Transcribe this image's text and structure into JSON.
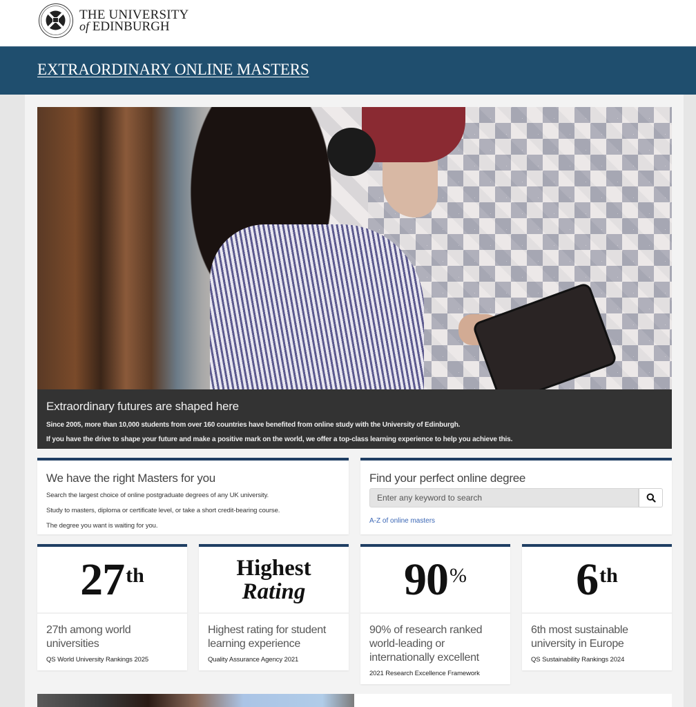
{
  "header": {
    "logo_line1": "THE UNIVERSITY",
    "logo_of": "of",
    "logo_line2": "EDINBURGH",
    "crest_icon": "university-crest-icon"
  },
  "banner": {
    "title": "EXTRAORDINARY ONLINE MASTERS"
  },
  "hero": {
    "image_alt": "Student with headphones using a tablet",
    "caption_title": "Extraordinary futures are shaped here",
    "caption_line1": "Since 2005, more than 10,000 students from over 160 countries have benefited from online study with the University of Edinburgh.",
    "caption_line2": "If you have the drive to shape your future and make a positive mark on the world, we offer a top-class learning experience to help you achieve this."
  },
  "masters_card": {
    "heading": "We have the right Masters for you",
    "lines": [
      "Search the largest choice of online postgraduate degrees of any UK university.",
      "Study to masters, diploma or certificate level, or take a short credit-bearing course.",
      "The degree you want is waiting for you."
    ]
  },
  "search_card": {
    "heading": "Find your perfect online degree",
    "placeholder": "Enter any keyword to search",
    "value": "",
    "search_icon": "search-icon",
    "az_link": "A-Z of online masters"
  },
  "stats": [
    {
      "big": "27",
      "sup": "th",
      "description": "27th among world universities",
      "source": "QS World University Rankings 2025"
    },
    {
      "word1": "Highest",
      "word2": "Rating",
      "description": "Highest rating for student learning experience",
      "source": "Quality Assurance Agency 2021"
    },
    {
      "big": "90",
      "sup": "%",
      "description": "90% of research ranked world-leading or internationally excellent",
      "source": "2021 Research Excellence Framework"
    },
    {
      "big": "6",
      "sup": "th",
      "description": "6th most sustainable university in Europe",
      "source": "QS Sustainability Rankings 2024"
    }
  ],
  "colors": {
    "brand_navy": "#1f4e6e",
    "card_accent": "#1f3e63",
    "caption_bg": "#333333",
    "link": "#3a66b5"
  }
}
